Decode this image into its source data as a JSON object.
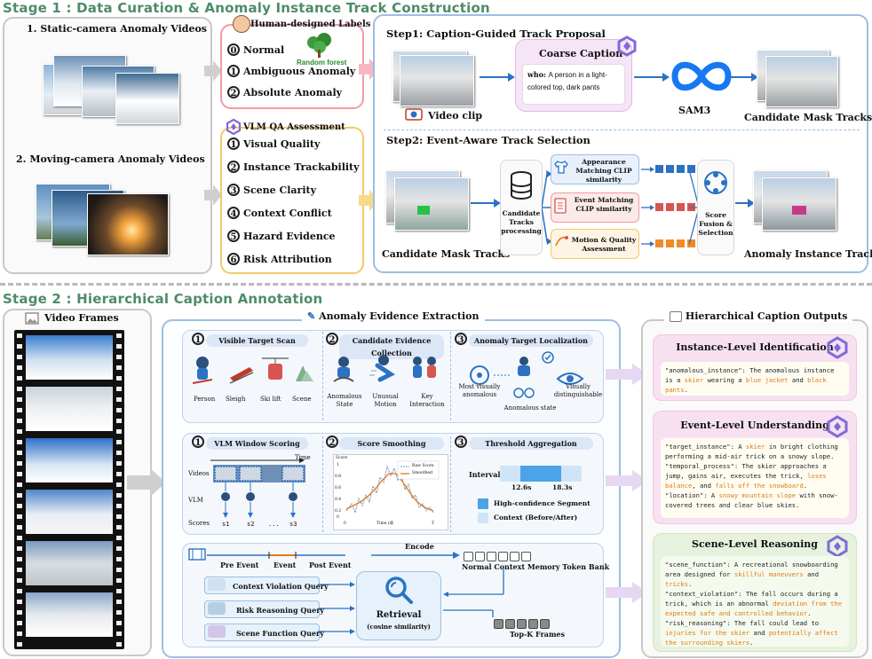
{
  "stage1": {
    "title": "Stage 1 : Data Curation & Anomaly Instance Track Construction",
    "static_label": "1. Static-camera Anomaly Videos",
    "moving_label": "2. Moving-camera Anomaly Videos",
    "human_labels": {
      "title": "Human-designed Labels",
      "items": [
        "Normal",
        "Ambiguous Anomaly",
        "Absolute Anomaly"
      ],
      "nums": [
        "0",
        "1",
        "2"
      ],
      "random_forest": "Random forest"
    },
    "vlm_qa": {
      "title": "VLM QA Assessment",
      "items": [
        "Visual Quality",
        "Instance Trackability",
        "Scene Clarity",
        "Context Conflict",
        "Hazard Evidence",
        "Risk Attribution"
      ],
      "nums": [
        "1",
        "2",
        "3",
        "4",
        "5",
        "6"
      ]
    },
    "step1": {
      "title": "Step1: Caption-Guided Track Proposal",
      "coarse_caption": "Coarse Caption",
      "caption_who": "who:",
      "caption_text": "A person in a light-colored top, dark pants",
      "video_clip": "Video clip",
      "sam3": "SAM3",
      "candidate": "Candidate Mask Tracks"
    },
    "step2": {
      "title": "Step2: Event-Aware Track Selection",
      "candidate_left": "Candidate Mask Tracks",
      "processing": "Candidate Tracks processing",
      "appearance": "Appearance Matching CLIP similarity",
      "event": "Event Matching CLIP similarity",
      "motion": "Motion & Quality Assessment",
      "fusion": "Score Fusion & Selection",
      "output": "Anomaly Instance Track"
    }
  },
  "stage2": {
    "title": "Stage 2 : Hierarchical Caption Annotation",
    "video_frames": "Video Frames",
    "extraction_title": "Anomaly Evidence Extraction",
    "outputs_title": "Hierarchical Caption Outputs",
    "row1": {
      "visible": {
        "num": "1",
        "title": "Visible Target Scan",
        "items": [
          "Person",
          "Sleigh",
          "Ski lift",
          "Scene"
        ]
      },
      "candidate": {
        "num": "2",
        "title": "Candidate Evidence Collection",
        "items": [
          "Anomalous State",
          "Unusual Motion",
          "Key Interaction"
        ]
      },
      "localization": {
        "num": "3",
        "title": "Anomaly Target Localization",
        "items": [
          "Most visually anomalous",
          "Anomalous state",
          "Visually distinguishable"
        ]
      }
    },
    "row2": {
      "window": {
        "num": "1",
        "title": "VLM Window Scoring",
        "time": "Time",
        "rows": [
          "Videos",
          "VLM",
          "Scores"
        ],
        "scores": [
          "s1",
          "s2",
          "...",
          "s3"
        ]
      },
      "smoothing": {
        "num": "2",
        "title": "Score Smoothing",
        "ylabel": "Score",
        "xlabel": "Time (s)",
        "legend": [
          "Raw Score",
          "Smoothed"
        ],
        "y_ticks": [
          "1",
          "0.8",
          "0.6",
          "0.4",
          "0.2",
          "0"
        ],
        "x_ticks": [
          "0",
          "5",
          "T"
        ]
      },
      "threshold": {
        "num": "3",
        "title": "Threshold Aggregation",
        "interval": "Interval",
        "t1": "12.6s",
        "t2": "18.3s",
        "legend1": "High-confidence Segment",
        "legend2": "Context (Before/After)"
      }
    },
    "row3": {
      "pre": "Pre Event",
      "event": "Event",
      "post": "Post Event",
      "encode": "Encode",
      "memory": "Normal Context Memory Token Bank",
      "queries": [
        "Context Violation Query",
        "Risk Reasoning Query",
        "Scene Function Query"
      ],
      "retrieval": "Retrieval",
      "retrieval_sub": "(cosine similarity)",
      "topk": "Top-K Frames"
    },
    "outputs": {
      "instance": {
        "title": "Instance-Level Identification",
        "key": "\"anomalous_instance\"",
        "text1": ": The anomalous instance is a ",
        "hl1": "skier",
        "text2": " wearing a ",
        "hl2": "blue jacket",
        "text3": " and ",
        "hl3": "black pants",
        "text4": "."
      },
      "event": {
        "title": "Event-Level Understanding",
        "k1": "\"target_instance\"",
        "t1a": ": A ",
        "h1a": "skier",
        "t1b": " in bright clothing performing a mid-air trick on a snowy slope.",
        "k2": "\"temporal_process\"",
        "t2a": ": The skier approaches a jump, gains air, executes the trick, ",
        "h2a": "loses balance",
        "t2b": ", and ",
        "h2b": "falls off the snowboard",
        "t2c": ".",
        "k3": "\"location\"",
        "t3a": ": A ",
        "h3a": "snowy mountain slope",
        "t3b": " with snow-covered trees and clear blue skies."
      },
      "scene": {
        "title": "Scene-Level Reasoning",
        "k1": "\"scene_function\"",
        "t1a": ": A recreational snowboarding area designed for ",
        "h1a": "skillful maneuvers",
        "t1b": " and ",
        "h1b": "tricks",
        "t1c": ".",
        "k2": "\"context_violation\"",
        "t2a": ": The fall occurs during a trick, which is an abnormal ",
        "h2a": "deviation from the expected safe and controlled behavior",
        "t2b": ".",
        "k3": "\"risk_reasoning\"",
        "t3a": ": The fall could lead to ",
        "h3a": "injuries for the skier",
        "t3b": " and ",
        "h3b": "potentially affect the surrounding skiers",
        "t3c": "."
      }
    }
  },
  "colors": {
    "stage_title": "#4d8c6a",
    "pink": "#f29aa6",
    "gold": "#f3c969",
    "blue_border": "#9dbfe0",
    "purple": "#7e6bd8",
    "highlight": "#e07b12",
    "green_text": "#3c8a3c"
  }
}
